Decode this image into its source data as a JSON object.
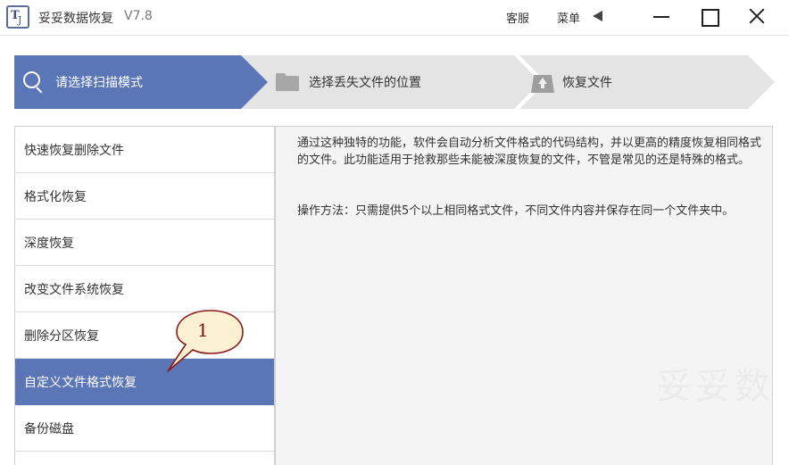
{
  "app": {
    "title": "妥妥数据恢复",
    "version": "V7.8"
  },
  "titlebar": {
    "service_label": "客服",
    "menu_label": "菜单"
  },
  "steps": [
    {
      "label": "请选择扫描模式",
      "icon": "search-icon",
      "active": true
    },
    {
      "label": "选择丢失文件的位置",
      "icon": "folder-icon",
      "active": false
    },
    {
      "label": "恢复文件",
      "icon": "restore-icon",
      "active": false
    }
  ],
  "modes": [
    {
      "label": "快速恢复删除文件"
    },
    {
      "label": "格式化恢复"
    },
    {
      "label": "深度恢复"
    },
    {
      "label": "改变文件系统恢复"
    },
    {
      "label": "删除分区恢复"
    },
    {
      "label": "自定义文件格式恢复",
      "selected": true
    },
    {
      "label": "备份磁盘"
    }
  ],
  "description": {
    "text": "通过这种独特的功能，软件会自动分析文件格式的代码结构，并以更高的精度恢复相同格式的文件。此功能适用于抢救那些未能被深度恢复的文件，不管是常见的还是特殊的格式。",
    "method": "操作方法：只需提供5个以上相同格式文件，不同文件内容并保存在同一个文件夹中。"
  },
  "callout": {
    "number": "1"
  },
  "watermark": "妥妥数",
  "colors": {
    "accent": "#5b76b6",
    "step_inactive": "#e4e4e4",
    "panel_bg": "#f4f4f4",
    "callout_fill": "#fbf0d2",
    "callout_border": "#8b1a1a"
  }
}
